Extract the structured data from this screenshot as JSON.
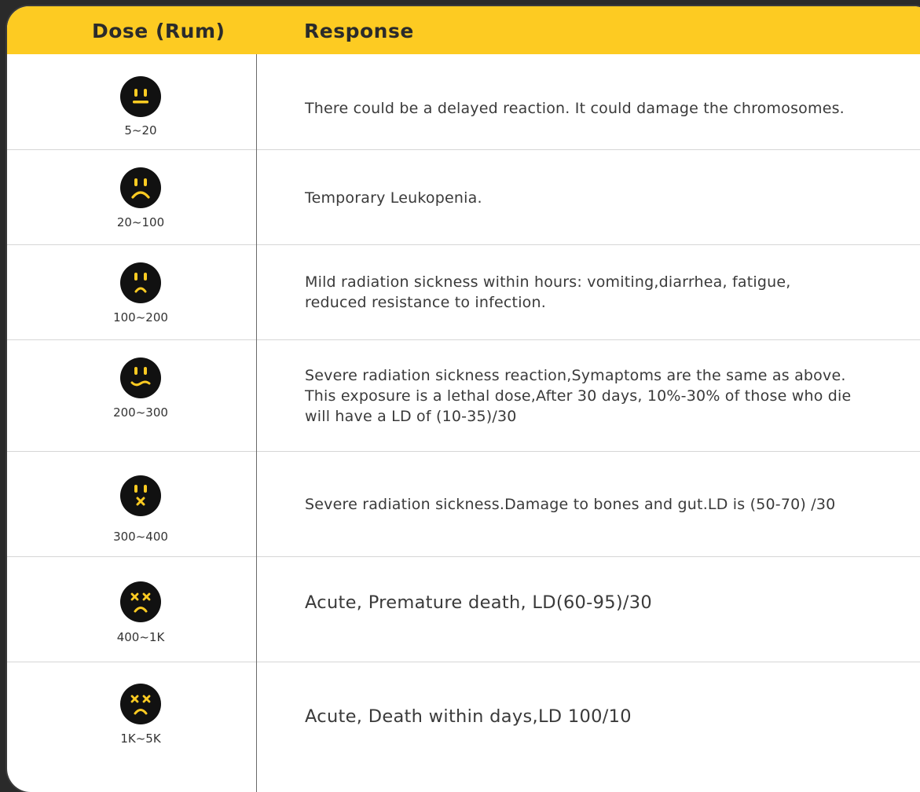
{
  "header": {
    "dose_label": "Dose (Rum)",
    "response_label": "Response"
  },
  "colors": {
    "accent": "#fdcb22",
    "face": "#111111",
    "face_feature": "#fdcb22"
  },
  "rows": [
    {
      "dose": "5~20",
      "icon": "neutral-face-icon",
      "response": "There could be a delayed reaction. It could damage the chromosomes."
    },
    {
      "dose": "20~100",
      "icon": "sad-face-icon",
      "response": "Temporary Leukopenia."
    },
    {
      "dose": "100~200",
      "icon": "worried-face-icon",
      "response": "Mild radiation sickness within hours: vomiting,diarrhea, fatigue, reduced resistance to infection."
    },
    {
      "dose": "200~300",
      "icon": "wavy-mouth-face-icon",
      "response": "Severe radiation sickness reaction,Symaptoms are the same as above. This exposure is a lethal dose,After 30 days, 10%-30% of those who die will have a LD of (10-35)/30"
    },
    {
      "dose": "300~400",
      "icon": "x-mouth-face-icon",
      "response": "Severe radiation sickness.Damage to bones and gut.LD is (50-70) /30"
    },
    {
      "dose": "400~1K",
      "icon": "x-eyes-face-icon",
      "response": "Acute, Premature death, LD(60-95)/30"
    },
    {
      "dose": "1K~5K",
      "icon": "x-eyes-face-icon",
      "response": "Acute, Death within days,LD 100/10"
    }
  ]
}
